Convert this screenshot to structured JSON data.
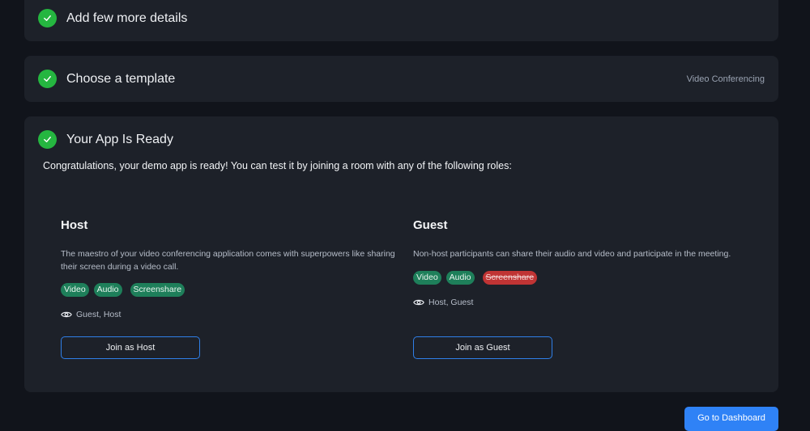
{
  "steps": [
    {
      "title": "Add few more details",
      "meta": ""
    },
    {
      "title": "Choose a template",
      "meta": "Video Conferencing"
    },
    {
      "title": "Your App Is Ready",
      "meta": ""
    }
  ],
  "ready": {
    "intro": "Congratulations, your demo app is ready! You can test it by joining a room with any of the following roles:",
    "roles": [
      {
        "title": "Host",
        "description": "The maestro of your video conferencing application comes with superpowers like sharing their screen during a video call.",
        "permissions": [
          {
            "label": "Video",
            "enabled": true
          },
          {
            "label": "Audio",
            "enabled": true
          },
          {
            "label": "Screenshare",
            "enabled": true
          }
        ],
        "visible_to": "Guest, Host",
        "join_label": "Join as Host"
      },
      {
        "title": "Guest",
        "description": "Non-host participants can share their audio and video and participate in the meeting.",
        "permissions": [
          {
            "label": "Video",
            "enabled": true
          },
          {
            "label": "Audio",
            "enabled": true
          },
          {
            "label": "Screenshare",
            "enabled": false
          }
        ],
        "visible_to": "Host, Guest",
        "join_label": "Join as Guest"
      }
    ]
  },
  "footer": {
    "dashboard_label": "Go to Dashboard"
  },
  "colors": {
    "success": "#25b640",
    "accent": "#2f82f6",
    "enabled_pill": "#1e7f5a",
    "disabled_pill": "#c03434"
  }
}
